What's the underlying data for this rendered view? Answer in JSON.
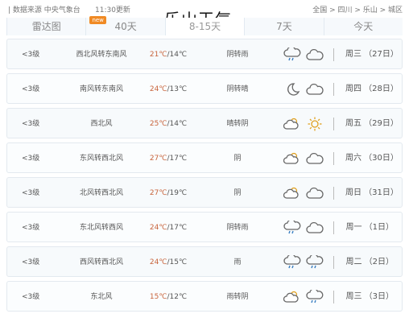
{
  "breadcrumb": {
    "path": "全国 > 四川 > 乐山 > 城区",
    "time": "11:30更新",
    "source": "| 数据来源 中央气象台"
  },
  "page_title": "乐山天气",
  "tabs": [
    {
      "label": "今天",
      "active": false
    },
    {
      "label": "7天",
      "active": false
    },
    {
      "label": "8-15天",
      "active": true
    },
    {
      "label": "40天",
      "active": false,
      "tag": "new"
    },
    {
      "label": "雷达图",
      "active": false
    }
  ],
  "forecast": [
    {
      "day": "周三 （27日）",
      "cond": "阴转雨",
      "temp_hi": "21℃",
      "temp_lo": "14℃",
      "wind": "西北风转东南风",
      "level": "<3级",
      "icons": [
        "cloud-icon",
        "cloud-rain-icon"
      ]
    },
    {
      "day": "周四 （28日）",
      "cond": "阴转晴",
      "temp_hi": "24℃",
      "temp_lo": "13℃",
      "wind": "南风转东南风",
      "level": "<3级",
      "icons": [
        "cloud-icon",
        "moon-icon"
      ]
    },
    {
      "day": "周五 （29日）",
      "cond": "晴转阴",
      "temp_hi": "25℃",
      "temp_lo": "14℃",
      "wind": "西北风",
      "level": "<3级",
      "icons": [
        "sun-icon",
        "partly-cloudy-icon"
      ]
    },
    {
      "day": "周六 （30日）",
      "cond": "阴",
      "temp_hi": "27℃",
      "temp_lo": "17℃",
      "wind": "东风转西北风",
      "level": "<3级",
      "icons": [
        "cloud-icon",
        "partly-cloudy-icon"
      ]
    },
    {
      "day": "周日 （31日）",
      "cond": "阴",
      "temp_hi": "27℃",
      "temp_lo": "19℃",
      "wind": "北风转西北风",
      "level": "<3级",
      "icons": [
        "cloud-icon",
        "partly-cloudy-icon"
      ]
    },
    {
      "day": "周一 （1日）",
      "cond": "阴转雨",
      "temp_hi": "24℃",
      "temp_lo": "17℃",
      "wind": "东北风转西风",
      "level": "<3级",
      "icons": [
        "cloud-icon",
        "cloud-rain-icon"
      ]
    },
    {
      "day": "周二 （2日）",
      "cond": "雨",
      "temp_hi": "24℃",
      "temp_lo": "15℃",
      "wind": "西风转西北风",
      "level": "<3级",
      "icons": [
        "cloud-rain-icon",
        "cloud-rain-icon"
      ]
    },
    {
      "day": "周三 （3日）",
      "cond": "雨转阴",
      "temp_hi": "15℃",
      "temp_lo": "12℃",
      "wind": "东北风",
      "level": "<3级",
      "icons": [
        "cloud-rain-icon",
        "partly-cloudy-icon"
      ]
    }
  ]
}
